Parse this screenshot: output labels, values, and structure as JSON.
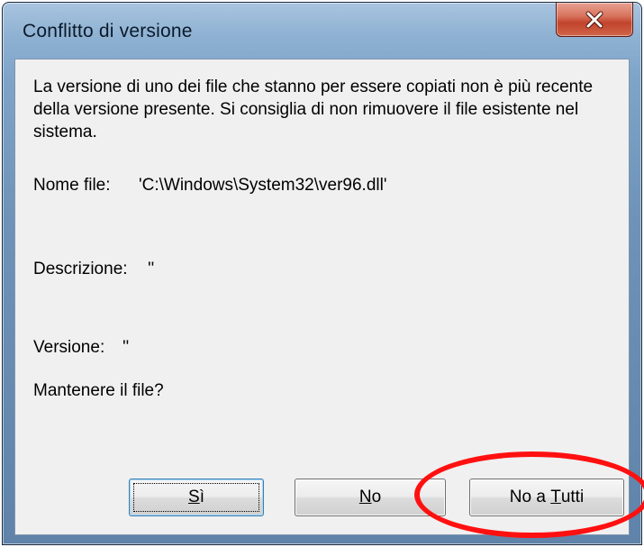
{
  "window": {
    "title": "Conflitto di versione",
    "close_label": "x"
  },
  "message": "La versione di uno dei file che stanno per essere copiati non è più recente della versione presente. Si consiglia di non rimuovere il file esistente nel sistema.",
  "fields": {
    "file_label": "Nome file:",
    "file_value": "'C:\\Windows\\System32\\ver96.dll'",
    "description_label": "Descrizione:",
    "description_value": "''",
    "version_label": "Versione:",
    "version_value": "''"
  },
  "question": "Mantenere il file?",
  "buttons": {
    "yes": {
      "mnemonic": "S",
      "rest": "ì"
    },
    "no": {
      "mnemonic": "N",
      "rest": "o"
    },
    "no_all": {
      "before": "No a ",
      "mnemonic": "T",
      "rest": "utti"
    }
  },
  "colors": {
    "callout": "#ff1010",
    "dialog_background": "#f0f0f0",
    "close_button": "#c2432b"
  },
  "icons": [
    "close-icon"
  ]
}
